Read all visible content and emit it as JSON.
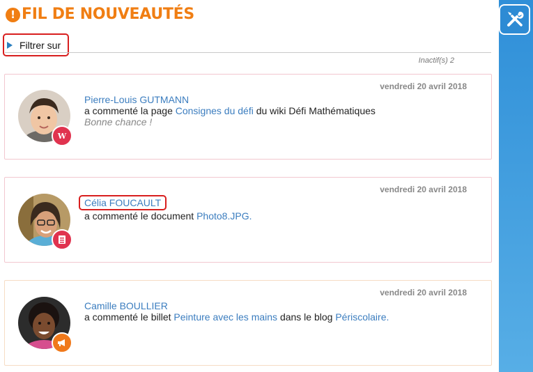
{
  "header": {
    "alert_glyph": "!",
    "title": "FIL DE NOUVEAUTÉS"
  },
  "filter": {
    "label": "Filtrer sur"
  },
  "inactive": {
    "label": "Inactif(s) 2"
  },
  "feed": [
    {
      "date": "vendredi 20 avril 2018",
      "author": "Pierre-Louis GUTMANN",
      "action": "a commenté la page",
      "target": "Consignes du défi",
      "mid": "du wiki Défi Mathématiques",
      "container": "",
      "end": "",
      "comment": "Bonne chance !",
      "badge_icon": "wiki-icon",
      "badge_glyph": "W",
      "badge_color": "#e0334f",
      "border_color": "#f2c7cf"
    },
    {
      "date": "vendredi 20 avril 2018",
      "author": "Célia FOUCAULT",
      "action": "a commenté le document",
      "target": "Photo8.JPG.",
      "mid": "",
      "container": "",
      "end": "",
      "comment": "",
      "badge_icon": "document-icon",
      "badge_glyph": "",
      "badge_color": "#e0334f",
      "border_color": "#f2c7cf"
    },
    {
      "date": "vendredi 20 avril 2018",
      "author": "Camille BOULLIER",
      "action": "a commenté le billet",
      "target": "Peinture avec les mains",
      "mid": "dans le blog",
      "container": "Périscolaire.",
      "end": "",
      "comment": "",
      "badge_icon": "megaphone-icon",
      "badge_glyph": "",
      "badge_color": "#f0791b",
      "border_color": "#f6dcc4"
    }
  ],
  "sidebar": {
    "tools_icon": "tools-icon"
  },
  "colors": {
    "accent_orange": "#f07e13",
    "link_blue": "#3b7dbf",
    "sidebar_blue": "#2f8fd8",
    "highlight_red": "#d81e1e"
  }
}
